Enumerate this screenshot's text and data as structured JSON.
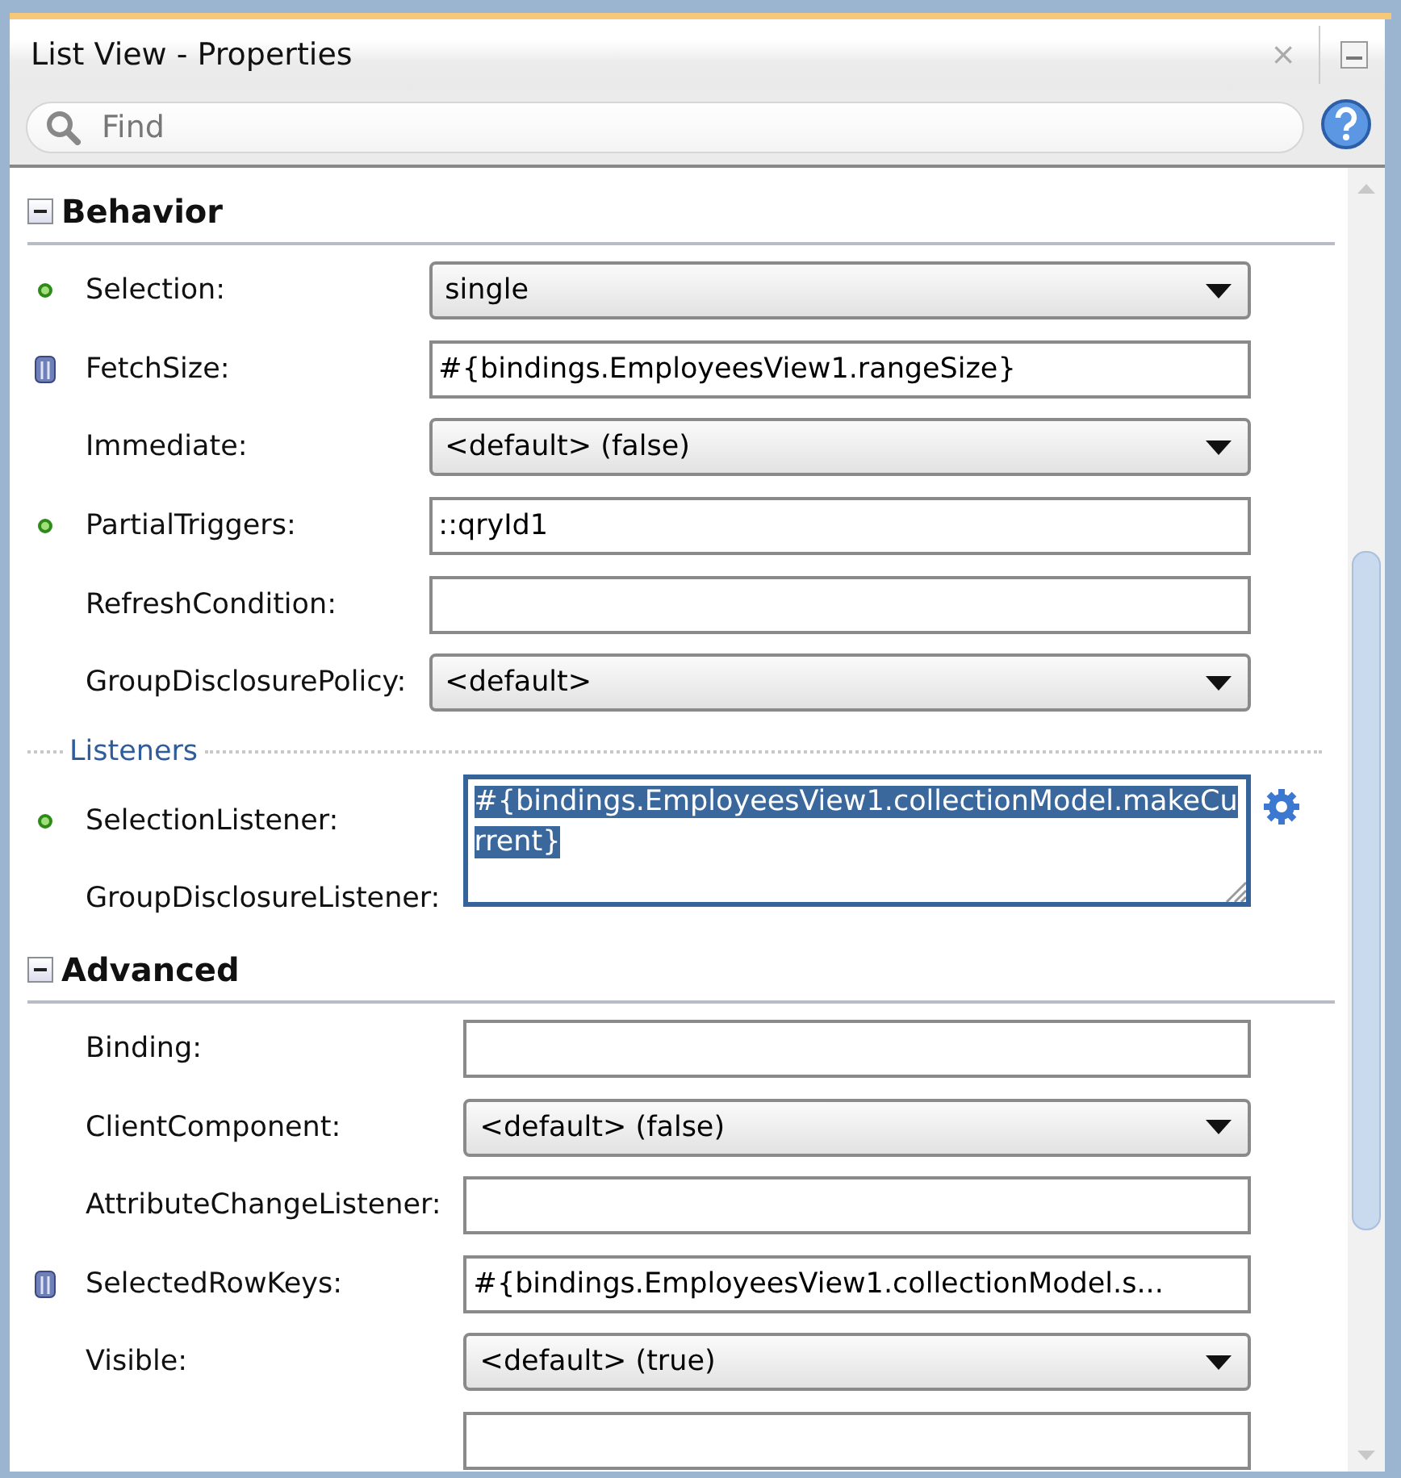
{
  "window": {
    "title": "List View - Properties",
    "close": "×"
  },
  "search": {
    "placeholder": "Find"
  },
  "sections": [
    {
      "title": "Behavior",
      "expanded": true,
      "items": [
        {
          "kind": "select",
          "label": "Selection:",
          "modified": true,
          "bound": false,
          "value": "single"
        },
        {
          "kind": "text",
          "label": "FetchSize:",
          "modified": false,
          "bound": true,
          "value": "#{bindings.EmployeesView1.rangeSize}"
        },
        {
          "kind": "select",
          "label": "Immediate:",
          "modified": false,
          "bound": false,
          "value": "<default> (false)"
        },
        {
          "kind": "text",
          "label": "PartialTriggers:",
          "modified": true,
          "bound": false,
          "value": "::qryId1"
        },
        {
          "kind": "text",
          "label": "RefreshCondition:",
          "modified": false,
          "bound": false,
          "value": ""
        },
        {
          "kind": "select",
          "label": "GroupDisclosurePolicy:",
          "modified": false,
          "bound": false,
          "value": "<default>"
        },
        {
          "kind": "group",
          "label": "Listeners"
        },
        {
          "kind": "textarea",
          "label": "SelectionListener:",
          "modified": true,
          "bound": false,
          "value": "#{bindings.EmployeesView1.collectionModel.makeCurrent}",
          "selected": true
        },
        {
          "kind": "covered",
          "label": "GroupDisclosureListener:",
          "modified": false,
          "bound": false
        }
      ]
    },
    {
      "title": "Advanced",
      "expanded": true,
      "items": [
        {
          "kind": "text",
          "label": "Binding:",
          "modified": false,
          "bound": false,
          "value": ""
        },
        {
          "kind": "select",
          "label": "ClientComponent:",
          "modified": false,
          "bound": false,
          "value": "<default> (false)"
        },
        {
          "kind": "text",
          "label": "AttributeChangeListener:",
          "modified": false,
          "bound": false,
          "value": ""
        },
        {
          "kind": "text",
          "label": "SelectedRowKeys:",
          "modified": false,
          "bound": true,
          "value": "#{bindings.EmployeesView1.collectionModel.s..."
        },
        {
          "kind": "select",
          "label": "Visible:",
          "modified": false,
          "bound": false,
          "value": "<default> (true)"
        },
        {
          "kind": "text",
          "value": ""
        }
      ]
    }
  ]
}
